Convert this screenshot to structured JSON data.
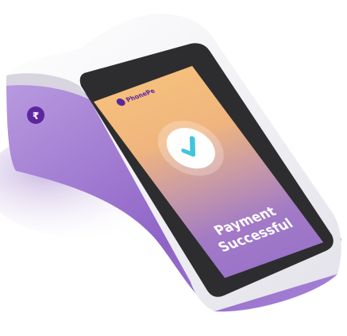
{
  "device": {
    "brand": "PhonePe",
    "status_message_line1": "Payment",
    "status_message_line2": "Successful",
    "status_icon": "checkmark-icon",
    "side_logo_icon": "phonepe-logo-icon"
  },
  "colors": {
    "brand_purple": "#5f259f",
    "screen_top": "#f5bf7c",
    "screen_bottom": "#9b74c9",
    "check": "#3fc6dc",
    "body_purple": "#9a72cf"
  }
}
